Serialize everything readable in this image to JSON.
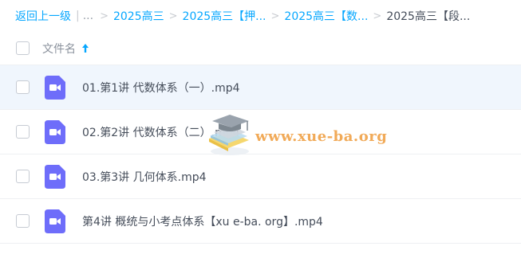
{
  "breadcrumb": {
    "back_label": "返回上一级",
    "pipe": "|",
    "ellipsis": "...",
    "items": [
      "2025高三",
      "2025高三【押...",
      "2025高三【数...",
      "2025高三【段..."
    ]
  },
  "header": {
    "filename_label": "文件名",
    "sort_icon": "arrow-up-icon"
  },
  "files": [
    {
      "name": "01.第1讲 代数体系（一）.mp4",
      "icon": "video-icon",
      "selected": true
    },
    {
      "name": "02.第2讲 代数体系（二）.mp4",
      "icon": "video-icon",
      "selected": false
    },
    {
      "name": "03.第3讲 几何体系.mp4",
      "icon": "video-icon",
      "selected": false
    },
    {
      "name": "第4讲 概统与小考点体系【xu e-ba. org】.mp4",
      "icon": "video-icon",
      "selected": false
    }
  ],
  "watermark": {
    "text": "www.xue-ba.org",
    "icon": "graduation-cap-books-icon"
  },
  "colors": {
    "link": "#06a7ff",
    "video_icon": "#6e6dfa",
    "selected_row": "#f0f6fd",
    "watermark": "#f0a34a"
  }
}
